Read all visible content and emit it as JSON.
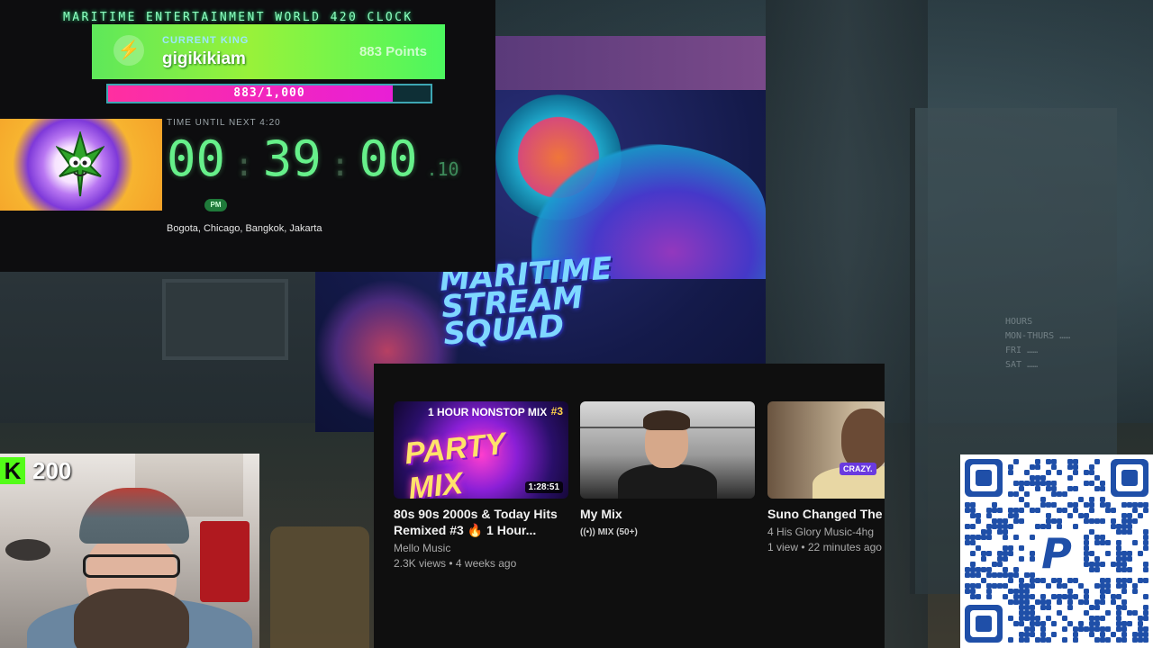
{
  "clock": {
    "heading": "MARITIME ENTERTAINMENT WORLD 420 CLOCK",
    "king_label": "CURRENT KING",
    "king_name": "gigikikiam",
    "king_points": "883 Points",
    "progress_text": "883/1,000",
    "progress_fraction": 0.883,
    "timer_label": "TIME UNTIL NEXT 4:20",
    "hours": "00",
    "minutes": "39",
    "seconds": "00",
    "fraction": ".10",
    "ampm": "PM",
    "cities": "Bogota, Chicago, Bangkok, Jakarta"
  },
  "poster": {
    "title_line1": "MARITIME",
    "title_line2": "STREAM",
    "title_line3": "SQUAD"
  },
  "youtube": {
    "videos": [
      {
        "thumb_top": "1 HOUR NONSTOP MIX",
        "thumb_badge": "#3",
        "thumb_big": "PARTY MIX",
        "duration": "1:28:51",
        "title": "80s 90s 2000s & Today Hits Remixed #3 🔥 1 Hour...",
        "channel": "Mello Music",
        "stats": "2.3K views • 4 weeks ago"
      },
      {
        "title": "My Mix",
        "mix_label": "((•)) MIX (50+)"
      },
      {
        "thumb_tag": "CRAZY.",
        "title": "Suno Changed The G",
        "channel": "4 His Glory Music-4hg",
        "stats": "1 view • 22 minutes ago"
      }
    ]
  },
  "kick": {
    "logo": "K",
    "count": "200"
  },
  "icons": {
    "bolt": "lightning-icon",
    "kick": "kick-logo-icon",
    "qr": "paypal-qr-icon"
  },
  "colors": {
    "timer_green": "#66f08a",
    "king_green": "#5ee85a",
    "progress_pink": "#ff2fa0",
    "kick_green": "#53fc18",
    "paypal_blue": "#1f4fa8"
  }
}
